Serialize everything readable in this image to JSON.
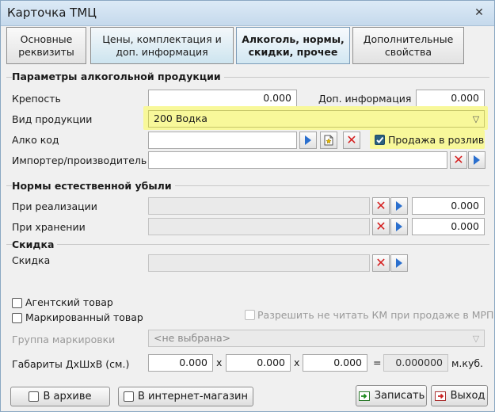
{
  "window": {
    "title": "Карточка ТМЦ",
    "close_glyph": "✕"
  },
  "tabs": [
    {
      "label1": "Основные",
      "label2": "реквизиты"
    },
    {
      "label1": "Цены, комплектация и",
      "label2": "доп.  информация"
    },
    {
      "label1": "Алкоголь, нормы,",
      "label2": "скидки, прочее"
    },
    {
      "label1": "Дополнительные",
      "label2": "свойства"
    }
  ],
  "alcohol": {
    "section_title": "Параметры алкогольной продукции",
    "strength_label": "Крепость",
    "strength_value": "0.000",
    "extra_info_label": "Доп. информация",
    "extra_info_value": "0.000",
    "product_type_label": "Вид продукции",
    "product_type_value": "200 Водка",
    "alco_code_label": "Алко код",
    "alco_code_value": "",
    "draft_sale_label": "Продажа в розлив",
    "draft_sale_checked": true,
    "importer_label": "Импортер/производитель",
    "importer_value": ""
  },
  "loss": {
    "section_title": "Нормы естественной убыли",
    "sale_label": "При реализации",
    "sale_value": "0.000",
    "storage_label": "При хранении",
    "storage_value": "0.000"
  },
  "discount": {
    "section_title": "Скидка",
    "label": "Скидка",
    "value": ""
  },
  "misc": {
    "agent_goods_label": "Агентский товар",
    "marked_goods_label": "Маркированный товар",
    "allow_no_km_label": "Разрешить не читать КМ при продаже в МРП",
    "marking_group_label": "Группа маркировки",
    "marking_group_value": "<не выбрана>",
    "dims_label": "Габариты ДхШхВ (см.)",
    "dim_l": "0.000",
    "dim_w": "0.000",
    "dim_h": "0.000",
    "x_sep": "x",
    "eq_sep": "=",
    "volume": "0.000000",
    "volume_unit": "м.куб."
  },
  "footer": {
    "archive_label": "В архиве",
    "internet_shop_label": "В интернет-магазин",
    "save_label": "Записать",
    "exit_label": "Выход"
  }
}
